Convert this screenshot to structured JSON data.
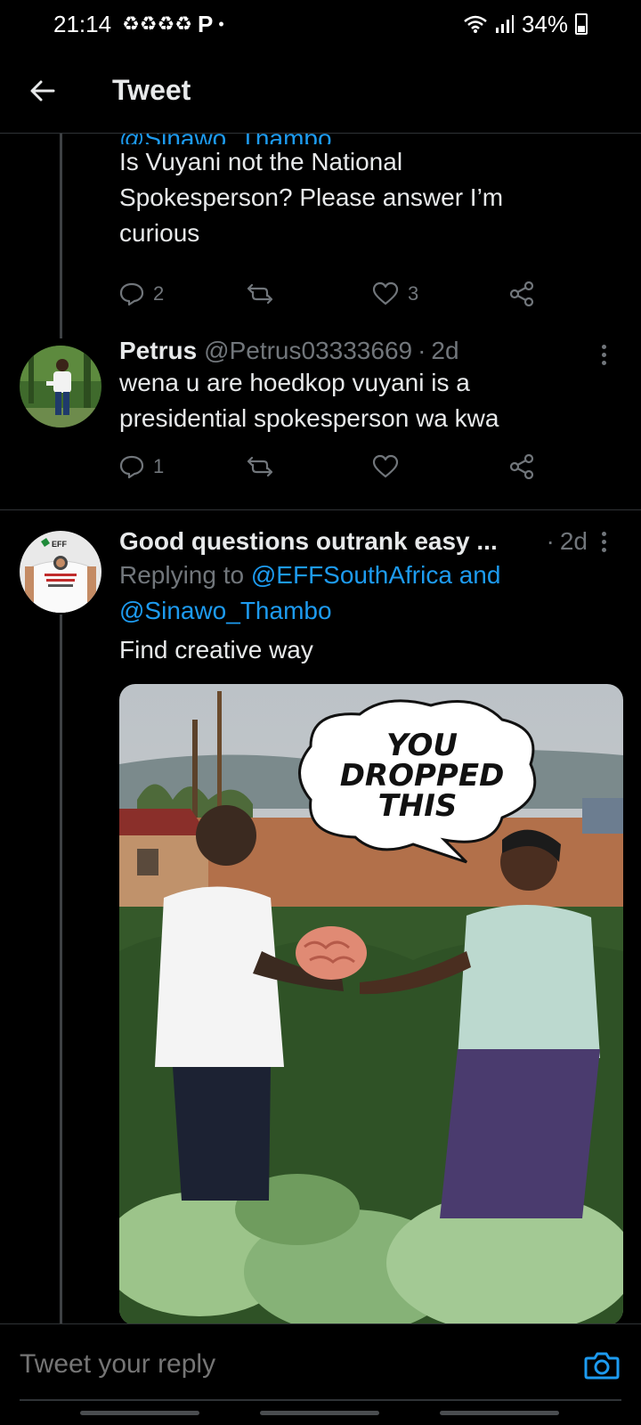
{
  "status": {
    "time": "21:14",
    "notif_icons": "♻♻♻♻",
    "p_letter": "P",
    "dot": "•",
    "battery": "34%"
  },
  "header": {
    "title": "Tweet"
  },
  "tweet1": {
    "mention_cut": "@Sinawo_Thambo",
    "text": "Is Vuyani not the National Spokesperson? Please answer I’m curious",
    "reply_count": "2",
    "retweet_count": "",
    "like_count": "3"
  },
  "tweet2": {
    "name": "Petrus",
    "handle": "@Petrus03333669",
    "dot": "·",
    "time": "2d",
    "text": "wena u are  hoedkop vuyani is a presidential spokesperson wa kwa",
    "reply_count": "1",
    "retweet_count": "",
    "like_count": ""
  },
  "tweet3": {
    "name": "Good questions outrank easy ...",
    "dot": "·",
    "time": "2d",
    "replying_to": "Replying to",
    "mention1": "@EFFSouthAfrica and",
    "mention2": "@Sinawo_Thambo",
    "text": "Find creative way",
    "image_bubble": [
      "YOU",
      "DROPPED",
      "THIS"
    ]
  },
  "reply_bar": {
    "placeholder": "Tweet your reply"
  },
  "colors": {
    "accent": "#1d9bf0",
    "muted": "#71767b",
    "background": "#000000"
  }
}
